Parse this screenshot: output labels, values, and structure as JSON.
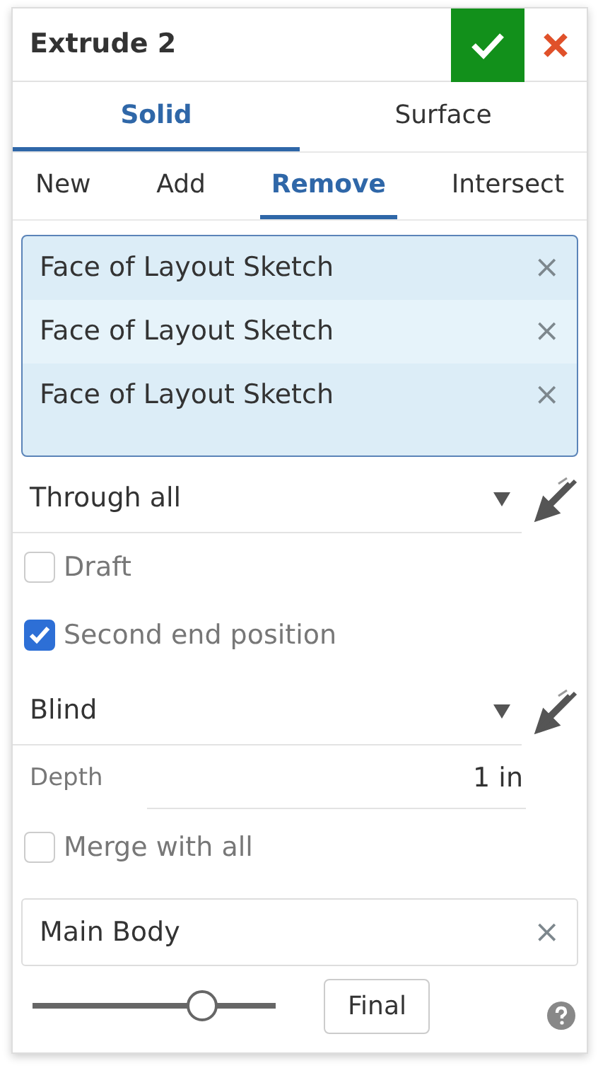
{
  "header": {
    "title": "Extrude 2"
  },
  "type_tabs": [
    {
      "label": "Solid",
      "selected": true
    },
    {
      "label": "Surface",
      "selected": false
    }
  ],
  "operation_tabs": [
    {
      "label": "New",
      "selected": false
    },
    {
      "label": "Add",
      "selected": false
    },
    {
      "label": "Remove",
      "selected": true
    },
    {
      "label": "Intersect",
      "selected": false
    }
  ],
  "selections": [
    {
      "label": "Face of Layout Sketch",
      "remove": "×"
    },
    {
      "label": "Face of Layout Sketch",
      "remove": "×"
    },
    {
      "label": "Face of Layout Sketch",
      "remove": "×"
    }
  ],
  "end_type": {
    "value": "Through all"
  },
  "draft": {
    "label": "Draft",
    "checked": false
  },
  "second_end": {
    "label": "Second end position",
    "checked": true
  },
  "second_end_type": {
    "value": "Blind"
  },
  "depth": {
    "label": "Depth",
    "value": "1 in"
  },
  "merge": {
    "label": "Merge with all",
    "checked": false
  },
  "merge_scope": {
    "value": "Main Body",
    "remove": "×"
  },
  "footer": {
    "slider": {
      "level": 0.7
    },
    "button": "Final"
  }
}
